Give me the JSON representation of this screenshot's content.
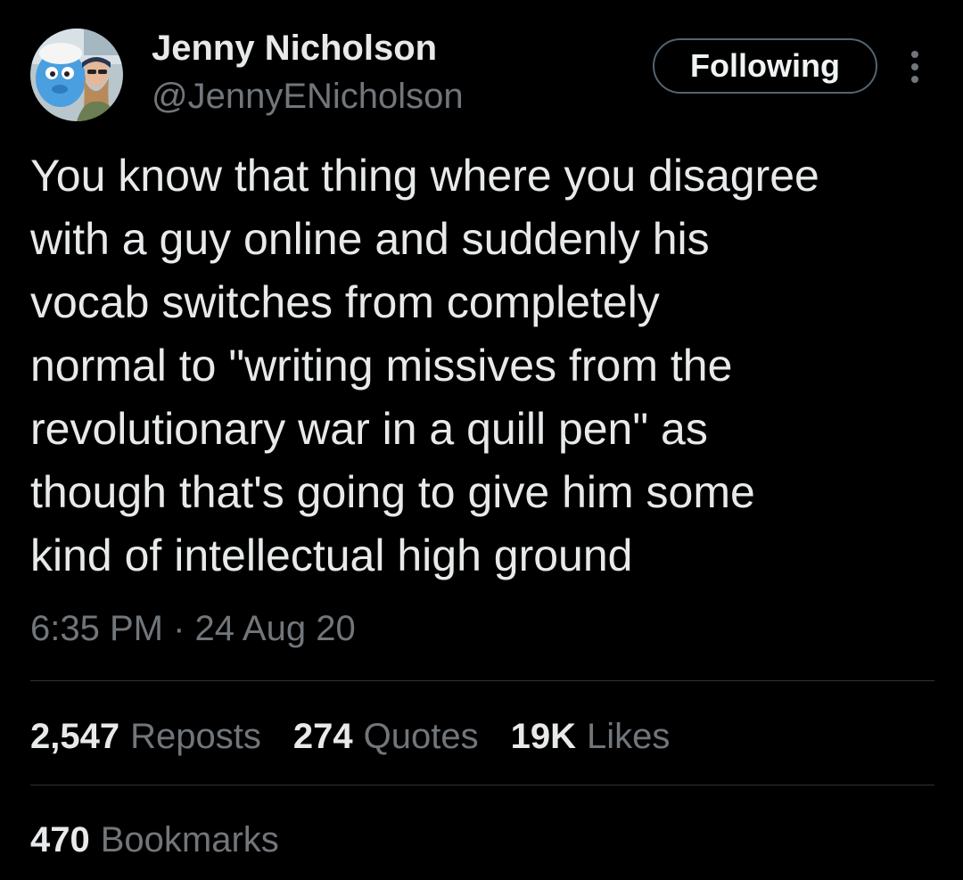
{
  "author": {
    "display_name": "Jenny Nicholson",
    "handle": "@JennyENicholson",
    "avatar_icon": "avatar-photo-icon"
  },
  "follow_button": {
    "label": "Following"
  },
  "more_button": {
    "icon": "more-vertical-icon"
  },
  "tweet": {
    "lines": [
      "You know that thing where you disagree",
      "with a guy online and suddenly his",
      "vocab switches from completely",
      "normal to \"writing missives from the",
      "revolutionary war in a quill pen\" as",
      "though that's going to give him some",
      "kind of intellectual high ground"
    ],
    "timestamp": "6:35 PM · 24 Aug 20"
  },
  "stats": {
    "reposts": {
      "value": "2,547",
      "label": "Reposts"
    },
    "quotes": {
      "value": "274",
      "label": "Quotes"
    },
    "likes": {
      "value": "19K",
      "label": "Likes"
    },
    "bookmarks": {
      "value": "470",
      "label": "Bookmarks"
    }
  },
  "colors": {
    "background": "#000000",
    "primary_text": "#e7e9ea",
    "secondary_text": "#71767b",
    "divider": "#2f3336",
    "button_border": "#536471"
  }
}
